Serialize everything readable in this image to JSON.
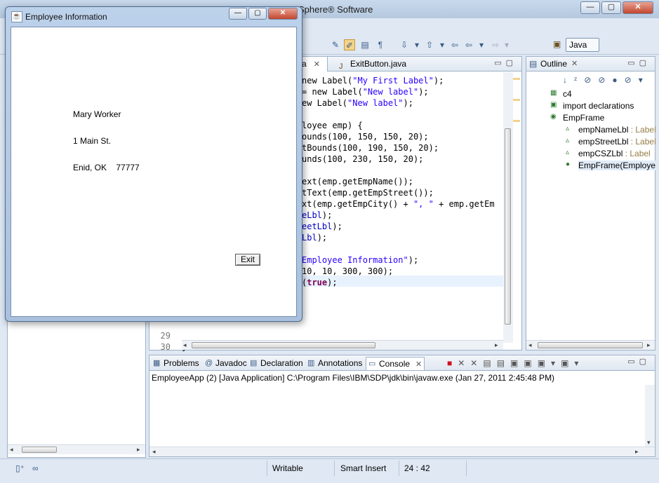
{
  "ide": {
    "title": "Sphere® Software",
    "perspective": "Java",
    "window_controls": {
      "min": "—",
      "max": "▢",
      "close": "✕"
    }
  },
  "editor": {
    "tabs": [
      {
        "label": "a",
        "close": "✕"
      },
      {
        "label": "ExitButton.java"
      }
    ],
    "code_lines": [
      {
        "parts": [
          [
            "new Label(",
            ""
          ],
          [
            "\"My First Label\"",
            "str"
          ],
          [
            ");",
            ""
          ]
        ]
      },
      {
        "parts": [
          [
            "= new Label(",
            ""
          ],
          [
            "\"New label\"",
            "str"
          ],
          [
            ");",
            ""
          ]
        ]
      },
      {
        "parts": [
          [
            "ew Label(",
            ""
          ],
          [
            "\"New label\"",
            "str"
          ],
          [
            ");",
            ""
          ]
        ]
      },
      {
        "parts": [
          [
            "",
            ""
          ]
        ]
      },
      {
        "parts": [
          [
            "loyee emp) {",
            ""
          ]
        ]
      },
      {
        "parts": [
          [
            "ounds(100, 150, 150, 20);",
            ""
          ]
        ]
      },
      {
        "parts": [
          [
            "tBounds(100, 190, 150, 20);",
            ""
          ]
        ]
      },
      {
        "parts": [
          [
            "unds(100, 230, 150, 20);",
            ""
          ]
        ]
      },
      {
        "parts": [
          [
            "",
            ""
          ]
        ]
      },
      {
        "parts": [
          [
            "ext(emp.getEmpName());",
            ""
          ]
        ]
      },
      {
        "parts": [
          [
            "tText(emp.getEmpStreet());",
            ""
          ]
        ]
      },
      {
        "parts": [
          [
            "xt(emp.getEmpCity() + ",
            ""
          ],
          [
            "\", \"",
            "str"
          ],
          [
            " + emp.getEm",
            ""
          ]
        ]
      },
      {
        "parts": [
          [
            "eLbl",
            "fld"
          ],
          [
            ");",
            ""
          ]
        ]
      },
      {
        "parts": [
          [
            "eetLbl",
            "fld"
          ],
          [
            ");",
            ""
          ]
        ]
      },
      {
        "parts": [
          [
            "Lbl",
            "fld"
          ],
          [
            ");",
            ""
          ]
        ]
      },
      {
        "parts": [
          [
            "",
            ""
          ]
        ]
      },
      {
        "parts": [
          [
            "Employee Information\"",
            "str"
          ],
          [
            ");",
            ""
          ]
        ]
      },
      {
        "parts": [
          [
            "10, 10, 300, 300);",
            ""
          ]
        ]
      },
      {
        "parts": [
          [
            "(",
            ""
          ],
          [
            "true",
            "kw"
          ],
          [
            ");",
            ""
          ]
        ]
      }
    ],
    "line_numbers": [
      {
        "no": "29",
        "text": "}"
      },
      {
        "no": "30",
        "text": ""
      }
    ]
  },
  "outline": {
    "title": "Outline",
    "items": [
      {
        "icon": "▦",
        "label": "c4",
        "type": ""
      },
      {
        "icon": "▣",
        "label": "import declarations",
        "type": ""
      },
      {
        "icon": "◉",
        "label": "EmpFrame",
        "type": ""
      },
      {
        "icon": "▵",
        "label": "empNameLbl",
        "type": " : Label"
      },
      {
        "icon": "▵",
        "label": "empStreetLbl",
        "type": " : Label"
      },
      {
        "icon": "▵",
        "label": "empCSZLbl",
        "type": " : Label"
      },
      {
        "icon": "●",
        "label": "EmpFrame(Employe",
        "type": ""
      }
    ]
  },
  "console_panel": {
    "tabs": [
      "Problems",
      "Javadoc",
      "Declaration",
      "Annotations",
      "Console"
    ],
    "active_tab": "Console",
    "process_line": "EmployeeApp (2) [Java Application] C:\\Program Files\\IBM\\SDP\\jdk\\bin\\javaw.exe (Jan 27, 2011 2:45:48 PM)"
  },
  "statusbar": {
    "mode": "Writable",
    "insert": "Smart Insert",
    "position": "24 : 42"
  },
  "dialog": {
    "title": "Employee Information",
    "name": "Mary Worker",
    "street": "1 Main St.",
    "city_state_zip": "Enid, OK    77777",
    "exit_label": "Exit",
    "controls": {
      "min": "—",
      "max": "▢",
      "close": "✕"
    }
  },
  "colors": {
    "string": "#2a00ff",
    "keyword": "#7f0055",
    "field": "#0000c0",
    "highlight_line": "#e8f2fe"
  }
}
